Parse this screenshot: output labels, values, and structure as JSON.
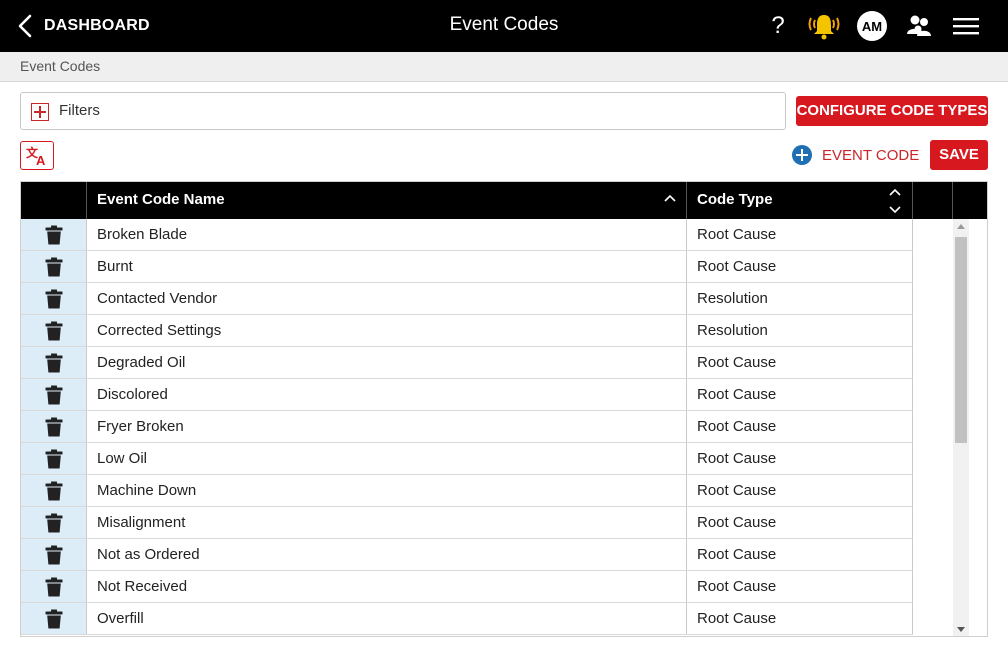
{
  "header": {
    "back_label": "DASHBOARD",
    "title": "Event Codes",
    "help_label": "?",
    "avatar_initials": "AM",
    "icons": [
      "chevron-left-icon",
      "help-icon",
      "bell-alert-icon",
      "users-icon",
      "hamburger-menu-icon"
    ]
  },
  "breadcrumb": "Event Codes",
  "filters": {
    "label": "Filters"
  },
  "actions": {
    "configure_label": "CONFIGURE CODE TYPES",
    "add_label": "EVENT CODE",
    "save_label": "SAVE"
  },
  "colors": {
    "accent_red": "#d7191f",
    "header_bg": "#000000",
    "delete_cell_bg": "#ddedf8",
    "add_icon_blue": "#1f6fb5"
  },
  "table": {
    "columns": [
      "Event Code Name",
      "Code Type"
    ],
    "rows": [
      {
        "name": "Broken Blade",
        "type": "Root Cause"
      },
      {
        "name": "Burnt",
        "type": "Root Cause"
      },
      {
        "name": "Contacted Vendor",
        "type": "Resolution"
      },
      {
        "name": "Corrected Settings",
        "type": "Resolution"
      },
      {
        "name": "Degraded Oil",
        "type": "Root Cause"
      },
      {
        "name": "Discolored",
        "type": "Root Cause"
      },
      {
        "name": "Fryer Broken",
        "type": "Root Cause"
      },
      {
        "name": "Low Oil",
        "type": "Root Cause"
      },
      {
        "name": "Machine Down",
        "type": "Root Cause"
      },
      {
        "name": "Misalignment",
        "type": "Root Cause"
      },
      {
        "name": "Not as Ordered",
        "type": "Root Cause"
      },
      {
        "name": "Not Received",
        "type": "Root Cause"
      },
      {
        "name": "Overfill",
        "type": "Root Cause"
      }
    ]
  }
}
